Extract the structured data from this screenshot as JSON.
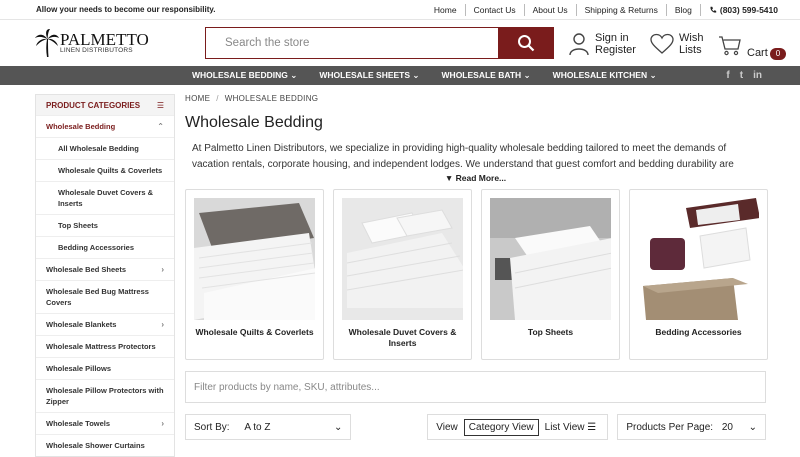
{
  "topbar": {
    "tagline": "Allow your needs to become our responsibility.",
    "links": [
      "Home",
      "Contact Us",
      "About Us",
      "Shipping & Returns",
      "Blog"
    ],
    "phone": "(803) 599-5410"
  },
  "logo": {
    "name": "PALMETTO",
    "sub": "LINEN DISTRIBUTORS"
  },
  "search": {
    "placeholder": "Search the store"
  },
  "header": {
    "sign_in": "Sign in",
    "register": "Register",
    "wish": "Wish",
    "lists": "Lists",
    "cart": "Cart",
    "cart_count": "0"
  },
  "nav": {
    "items": [
      "WHOLESALE BEDDING",
      "WHOLESALE SHEETS",
      "WHOLESALE BATH",
      "WHOLESALE KITCHEN"
    ],
    "social": [
      "f",
      "t",
      "in"
    ]
  },
  "sidebar": {
    "title": "PRODUCT CATEGORIES",
    "items": [
      "Wholesale Bedding",
      "All Wholesale Bedding",
      "Wholesale Quilts & Coverlets",
      "Wholesale Duvet Covers & Inserts",
      "Top Sheets",
      "Bedding Accessories",
      "Wholesale Bed Sheets",
      "Wholesale Bed Bug Mattress Covers",
      "Wholesale Blankets",
      "Wholesale Mattress Protectors",
      "Wholesale Pillows",
      "Wholesale Pillow Protectors with Zipper",
      "Wholesale Towels",
      "Wholesale Shower Curtains"
    ]
  },
  "breadcrumb": [
    "HOME",
    "WHOLESALE BEDDING"
  ],
  "page_title": "Wholesale Bedding",
  "description": "At Palmetto Linen Distributors, we specialize in providing high-quality wholesale bedding tailored to meet the demands of vacation rentals, corporate housing, and independent lodges. We understand that guest comfort and bedding durability are",
  "read_more": "▼ Read More...",
  "cards": [
    "Wholesale Quilts & Coverlets",
    "Wholesale Duvet Covers & Inserts",
    "Top Sheets",
    "Bedding Accessories"
  ],
  "filter": {
    "placeholder": "Filter products by name, SKU, attributes..."
  },
  "controls": {
    "sort_label": "Sort By:",
    "sort_value": "A to Z",
    "view_label": "View",
    "category_view": "Category View",
    "list_view": "List View",
    "per_page_label": "Products Per Page:",
    "per_page_value": "20"
  },
  "colors": {
    "brand": "#7a1c1c",
    "nav": "#555555"
  }
}
